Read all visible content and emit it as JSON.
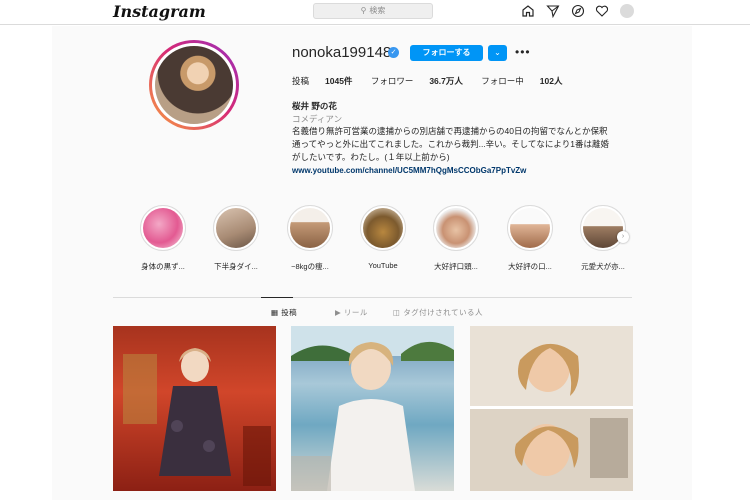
{
  "header": {
    "logo": "Instagram",
    "search_placeholder": "検索",
    "nav_icons": [
      "home-icon",
      "direct-icon",
      "explore-icon",
      "activity-heart-icon",
      "profile-avatar"
    ]
  },
  "profile": {
    "username": "nonoka199148",
    "verified": true,
    "follow_label": "フォローする",
    "dropdown_icon": "chevron-down-icon",
    "more_icon": "more-icon",
    "stats": {
      "posts_label": "投稿",
      "posts_count": "1045件",
      "followers_label": "フォロワー",
      "followers_count": "36.7万人",
      "following_label": "フォロー中",
      "following_count": "102人"
    },
    "display_name": "桜井 野の花",
    "category": "コメディアン",
    "bio_lines": [
      "名義借り無許可営業の逮捕からの別店舗で再逮捕からの40日の拘留でなんとか保釈",
      "通ってやっと外に出てこれました。これから裁判...辛い。そしてなにより1番は離婚",
      "がしたいです。わたし。(１年以上前から)"
    ],
    "link": "www.youtube.com/channel/UC5MM7hQgMsCCObGa7PpTvZw"
  },
  "highlights": [
    {
      "label": "身体の黒ず..."
    },
    {
      "label": "下半身ダイ..."
    },
    {
      "label": "−8kgの痩..."
    },
    {
      "label": "YouTube"
    },
    {
      "label": "大好評口頭..."
    },
    {
      "label": "大好評の口..."
    },
    {
      "label": "元愛犬が亦..."
    }
  ],
  "tabs": [
    {
      "icon": "grid-icon",
      "label": "投稿"
    },
    {
      "icon": "reels-icon",
      "label": "リール"
    },
    {
      "icon": "tagged-icon",
      "label": "タグ付けされている人"
    }
  ],
  "colors": {
    "accent": "#0095f6",
    "link": "#00376b",
    "muted": "#8e8e8e"
  }
}
